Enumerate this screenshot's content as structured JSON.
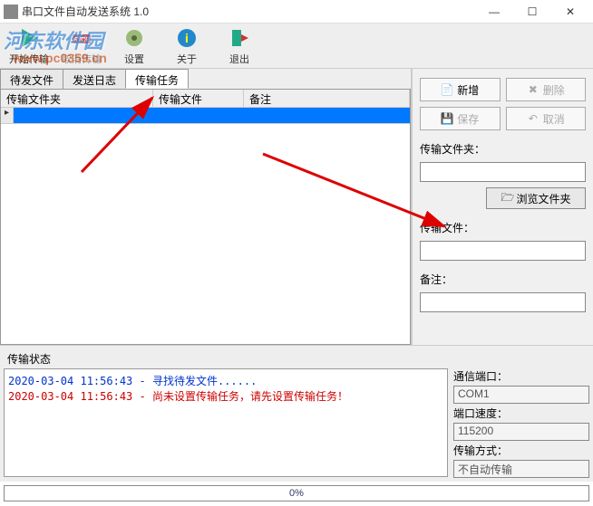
{
  "window": {
    "title": "串口文件自动发送系统 1.0",
    "controls": {
      "min": "—",
      "max": "☐",
      "close": "✕"
    }
  },
  "watermark": {
    "site": "河东软件园",
    "url": "www.pc0359.cn"
  },
  "toolbar": {
    "start": "开始传输",
    "cancel": "取消传输",
    "settings": "设置",
    "about": "关于",
    "exit": "退出"
  },
  "tabs": {
    "pending": "待发文件",
    "log": "发送日志",
    "tasks": "传输任务"
  },
  "table": {
    "col1": "传输文件夹",
    "col2": "传输文件",
    "col3": "备注"
  },
  "panel": {
    "new": "新增",
    "delete": "删除",
    "save": "保存",
    "cancel": "取消",
    "folder_label": "传输文件夹：",
    "browse": "浏览文件夹",
    "file_label": "传输文件：",
    "note_label": "备注：",
    "folder_value": "",
    "file_value": "",
    "note_value": ""
  },
  "status": {
    "label": "传输状态",
    "line1_ts": "2020-03-04 11:56:43 - ",
    "line1_msg": "寻找待发文件......",
    "line2_ts": "2020-03-04 11:56:43 - ",
    "line2_msg": "尚未设置传输任务，请先设置传输任务！",
    "port_label": "通信端口：",
    "port_value": "COM1",
    "baud_label": "端口速度：",
    "baud_value": "115200",
    "mode_label": "传输方式：",
    "mode_value": "不自动传输"
  },
  "progress": {
    "text": "0%"
  }
}
